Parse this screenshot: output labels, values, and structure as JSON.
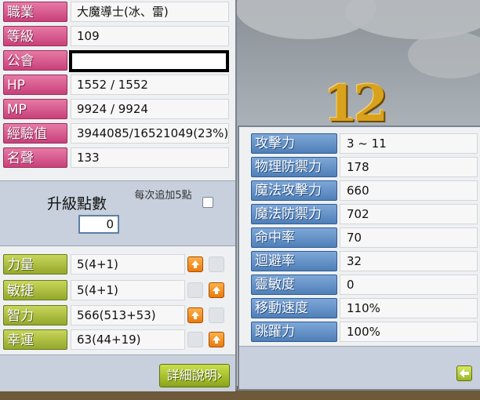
{
  "character": {
    "job": {
      "label": "職業",
      "value": "大魔導士(冰、雷)"
    },
    "level": {
      "label": "等級",
      "value": "109"
    },
    "guild": {
      "label": "公會",
      "value": ""
    },
    "hp": {
      "label": "HP",
      "value": "1552 / 1552"
    },
    "mp": {
      "label": "MP",
      "value": "9924 / 9924"
    },
    "exp": {
      "label": "經驗值",
      "value": "3944085/16521049(23%)"
    },
    "fame": {
      "label": "名聲",
      "value": "133"
    }
  },
  "ability_points": {
    "title": "升級點數",
    "value": "0",
    "auto_label": "每次追加5點",
    "auto_checked": false
  },
  "attributes": [
    {
      "label": "力量",
      "value": "5(4+1)",
      "plus_enabled": true
    },
    {
      "label": "敏捷",
      "value": "5(4+1)",
      "plus_enabled": true
    },
    {
      "label": "智力",
      "value": "566(513+53)",
      "plus_enabled": true
    },
    {
      "label": "幸運",
      "value": "63(44+19)",
      "plus_enabled": true
    }
  ],
  "detail_button_label": "詳細說明›",
  "detail_stats": [
    {
      "label": "攻擊力",
      "value": "3 ~ 11"
    },
    {
      "label": "物理防禦力",
      "value": "178"
    },
    {
      "label": "魔法攻擊力",
      "value": "660"
    },
    {
      "label": "魔法防禦力",
      "value": "702"
    },
    {
      "label": "命中率",
      "value": "70"
    },
    {
      "label": "迴避率",
      "value": "32"
    },
    {
      "label": "靈敏度",
      "value": "0"
    },
    {
      "label": "移動速度",
      "value": "110%"
    },
    {
      "label": "跳躍力",
      "value": "100%"
    }
  ],
  "background": {
    "level_badge": "12"
  },
  "colors": {
    "pink_label": "#d9558e",
    "olive_label": "#a8bb38",
    "blue_label": "#5b8bc4",
    "plus_button": "#f08c1c"
  }
}
